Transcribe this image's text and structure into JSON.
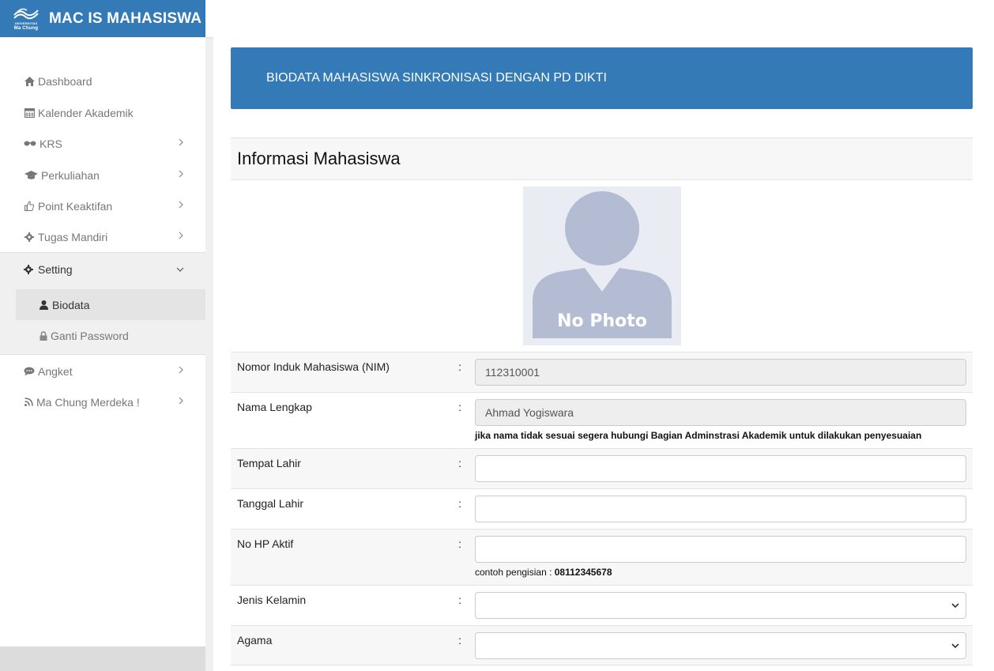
{
  "brand": {
    "title": "MAC IS MAHASISWA",
    "logo_top": "UNIVERSITAS",
    "logo_bottom": "Ma Chung"
  },
  "sidebar": {
    "items": [
      {
        "label": "Dashboard",
        "icon": "home-icon"
      },
      {
        "label": "Kalender Akademik",
        "icon": "calendar-icon"
      },
      {
        "label": "KRS",
        "icon": "glasses-icon"
      },
      {
        "label": "Perkuliahan",
        "icon": "graduation-cap-icon"
      },
      {
        "label": "Point Keaktifan",
        "icon": "thumbs-up-icon"
      },
      {
        "label": "Tugas Mandiri",
        "icon": "gear-icon"
      }
    ],
    "setting": {
      "label": "Setting",
      "icon": "gear-icon",
      "sub_items": [
        {
          "label": "Biodata",
          "icon": "user-icon"
        },
        {
          "label": "Ganti Password",
          "icon": "lock-icon"
        }
      ]
    },
    "bottom_items": [
      {
        "label": "Angket",
        "icon": "comment-icon"
      },
      {
        "label": "Ma Chung Merdeka !",
        "icon": "rss-icon"
      }
    ]
  },
  "page": {
    "header": "BIODATA MAHASISWA SINKRONISASI DENGAN PD DIKTI",
    "panel_title": "Informasi Mahasiswa",
    "photo_text": "No Photo"
  },
  "form": {
    "colon": ":",
    "nim": {
      "label": "Nomor Induk Mahasiswa (NIM)",
      "value": "112310001"
    },
    "nama": {
      "label": "Nama Lengkap",
      "value": "Ahmad Yogiswara",
      "help": "jika nama tidak sesuai segera hubungi Bagian Adminstrasi Akademik untuk dilakukan penyesuaian"
    },
    "tempat_lahir": {
      "label": "Tempat Lahir",
      "value": ""
    },
    "tanggal_lahir": {
      "label": "Tanggal Lahir",
      "value": ""
    },
    "no_hp": {
      "label": "No HP Aktif",
      "value": "",
      "help_prefix": "contoh pengisian : ",
      "help_example": "08112345678"
    },
    "jenis_kelamin": {
      "label": "Jenis Kelamin",
      "value": ""
    },
    "agama": {
      "label": "Agama",
      "value": ""
    }
  },
  "colors": {
    "primary": "#337ab7",
    "sidebar_bg": "#ffffff",
    "active_bg": "#e4e4e4"
  }
}
